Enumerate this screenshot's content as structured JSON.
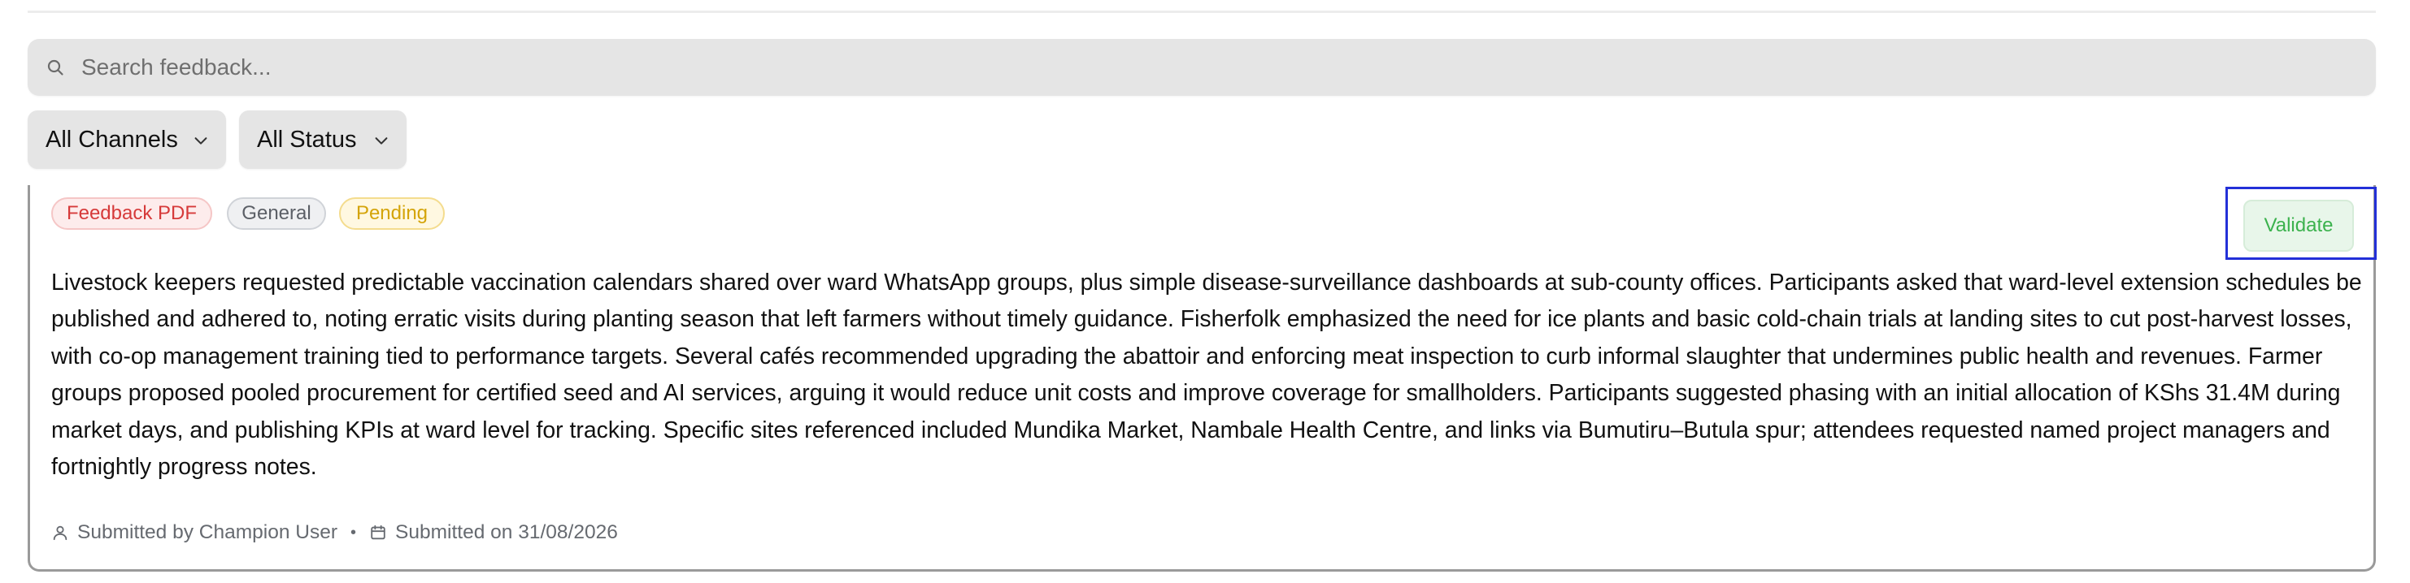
{
  "search": {
    "placeholder": "Search feedback..."
  },
  "filters": {
    "channel": {
      "selected": "All Channels"
    },
    "status": {
      "selected": "All Status"
    }
  },
  "feedback_item": {
    "source_badge": "Feedback PDF",
    "category_badge": "General",
    "status_badge": "Pending",
    "validate_label": "Validate",
    "text": "Livestock keepers requested predictable vaccination calendars shared over ward WhatsApp groups, plus simple disease-surveillance dashboards at sub-county offices. Participants asked that ward-level extension schedules be published and adhered to, noting erratic visits during planting season that left farmers without timely guidance. Fisherfolk emphasized the need for ice plants and basic cold-chain trials at landing sites to cut post-harvest losses, with co-op management training tied to performance targets. Several cafés recommended upgrading the abattoir and enforcing meat inspection to curb informal slaughter that undermines public health and revenues. Farmer groups proposed pooled procurement for certified seed and AI services, arguing it would reduce unit costs and improve coverage for smallholders. Participants suggested phasing with an initial allocation of KShs 31.4M during market days, and publishing KPIs at ward level for tracking. Specific sites referenced included Mundika Market, Nambale Health Centre, and links via Bumutiru–Butula spur; attendees requested named project managers and fortnightly progress notes.",
    "submitted_by": "Submitted by Champion User",
    "separator": "•",
    "submitted_on": "Submitted on 31/08/2026"
  },
  "icons": {
    "search": "search-icon",
    "chevron": "chevron-down-icon",
    "user": "user-icon",
    "calendar": "calendar-icon"
  },
  "colors": {
    "source_badge": "#d63a3a",
    "category_badge": "#5b5f66",
    "status_badge": "#d4a409",
    "validate": "#3bb24d",
    "focus_outline": "#2330d8"
  }
}
